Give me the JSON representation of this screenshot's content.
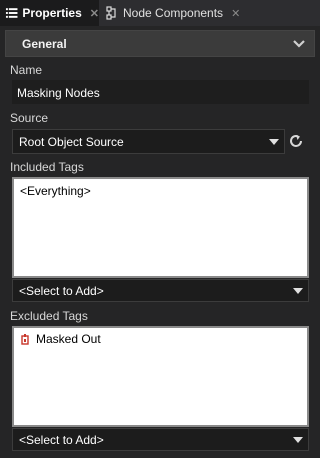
{
  "tabs": [
    {
      "label": "Properties",
      "icon": "list-icon",
      "close": "✕"
    },
    {
      "label": "Node Components",
      "icon": "node-components-icon",
      "close": "✕"
    }
  ],
  "section": {
    "title": "General"
  },
  "name": {
    "label": "Name",
    "value": "Masking Nodes"
  },
  "source": {
    "label": "Source",
    "value": "Root Object Source"
  },
  "included_tags": {
    "label": "Included Tags",
    "items": [
      "<Everything>"
    ],
    "add_label": "<Select to Add>"
  },
  "excluded_tags": {
    "label": "Excluded Tags",
    "items": [
      "Masked Out"
    ],
    "add_label": "<Select to Add>"
  },
  "colors": {
    "accent_tag_icon": "#c8362a",
    "panel": "#252526",
    "listbox": "#ffffff"
  }
}
